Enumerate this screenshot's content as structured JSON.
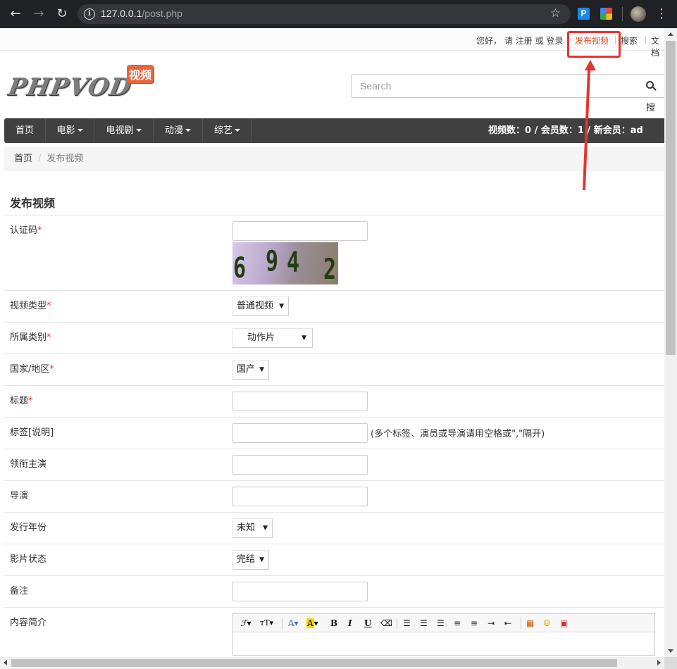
{
  "browser": {
    "url_host": "127.0.0.1",
    "url_path": "/post.php",
    "ext_p_label": "P"
  },
  "topbar": {
    "greeting": "您好，",
    "please": "请",
    "register": "注册",
    "or": "或",
    "login": "登录",
    "post_video": "发布视频",
    "search": "搜索",
    "docs": "文档"
  },
  "logo": {
    "text": "PHPVOD",
    "badge": "视频"
  },
  "search": {
    "placeholder": "Search",
    "button": "搜"
  },
  "nav": {
    "items": [
      "首页",
      "电影",
      "电视剧",
      "动漫",
      "综艺"
    ],
    "stats": "视频数：0 / 会员数：1 / 新会员：ad"
  },
  "breadcrumb": {
    "home": "首页",
    "separator": "/",
    "current": "发布视频"
  },
  "form": {
    "title": "发布视频",
    "captcha_label": "认证码",
    "captcha_chars": [
      "6",
      "9",
      "4",
      "2"
    ],
    "video_type_label": "视频类型",
    "video_type_value": "普通视频",
    "category_label": "所属类别",
    "category_value": "动作片",
    "country_label": "国家/地区",
    "country_value": "国产",
    "title_label": "标题",
    "tags_label": "标签[说明]",
    "tags_hint": "(多个标签、演员或导演请用空格或\",\"隔开)",
    "actors_label": "领衔主演",
    "director_label": "导演",
    "year_label": "发行年份",
    "year_value": "未知",
    "status_label": "影片状态",
    "status_value": "完结",
    "notes_label": "备注",
    "summary_label": "内容简介",
    "required_mark": "*"
  },
  "editor": {
    "tools": [
      "font-family",
      "font-size",
      "font-color",
      "back-color",
      "bold",
      "italic",
      "underline",
      "remove-format",
      "align-left",
      "align-center",
      "align-right",
      "ordered-list",
      "unordered-list",
      "indent",
      "outdent",
      "image",
      "emoticon",
      "fullscreen"
    ],
    "labels": {
      "font_family": "ℱ",
      "font_size": "тT",
      "font_color": "A",
      "back_color": "A",
      "bold": "B",
      "italic": "I",
      "underline": "U"
    }
  },
  "colors": {
    "accent": "#e8492b",
    "nav_bg": "#404040",
    "annotation": "#e8332c",
    "logo_badge": "#e8663e"
  }
}
